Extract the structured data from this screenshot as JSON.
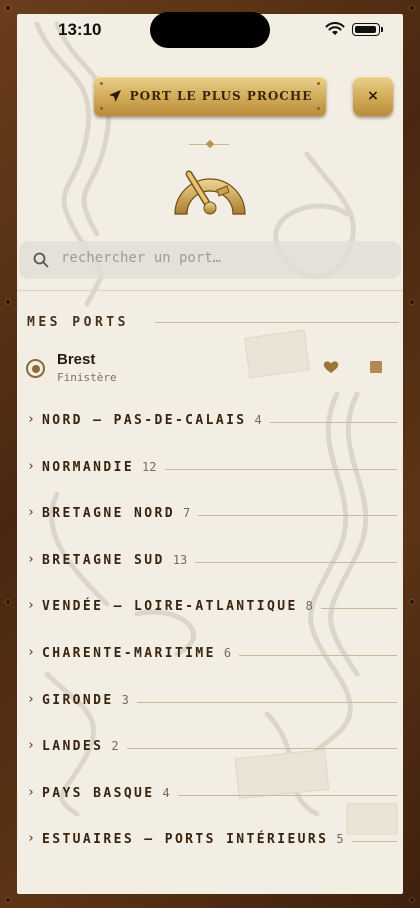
{
  "status": {
    "time": "13:10"
  },
  "header": {
    "nearest_label": "PORT LE PLUS PROCHE",
    "close_label": "×"
  },
  "search": {
    "placeholder": "rechercher un port…"
  },
  "my_ports": {
    "title": "MES PORTS",
    "items": [
      {
        "name": "Brest",
        "subtitle": "Finistère",
        "selected": true,
        "favorite": true
      }
    ]
  },
  "regions": [
    {
      "label": "NORD — PAS-DE-CALAIS",
      "count": "4"
    },
    {
      "label": "NORMANDIE",
      "count": "12"
    },
    {
      "label": "BRETAGNE NORD",
      "count": "7"
    },
    {
      "label": "BRETAGNE SUD",
      "count": "13"
    },
    {
      "label": "VENDÉE — LOIRE-ATLANTIQUE",
      "count": "8"
    },
    {
      "label": "CHARENTE-MARITIME",
      "count": "6"
    },
    {
      "label": "GIRONDE",
      "count": "3"
    },
    {
      "label": "LANDES",
      "count": "2"
    },
    {
      "label": "PAYS BASQUE",
      "count": "4"
    },
    {
      "label": "ESTUAIRES — PORTS INTÉRIEURS",
      "count": "5"
    }
  ],
  "colors": {
    "frame_wood": "#4a2810",
    "paper": "#f3eee3",
    "gold": "#d3ad5b",
    "text_dark": "#3a2410",
    "accent_brass": "#b08a4e"
  },
  "icons": {
    "nearest": "location-arrow-icon",
    "close": "close-icon",
    "logo": "sextant-icon",
    "search": "search-icon",
    "favorite": "heart-icon",
    "square": "square-icon"
  }
}
